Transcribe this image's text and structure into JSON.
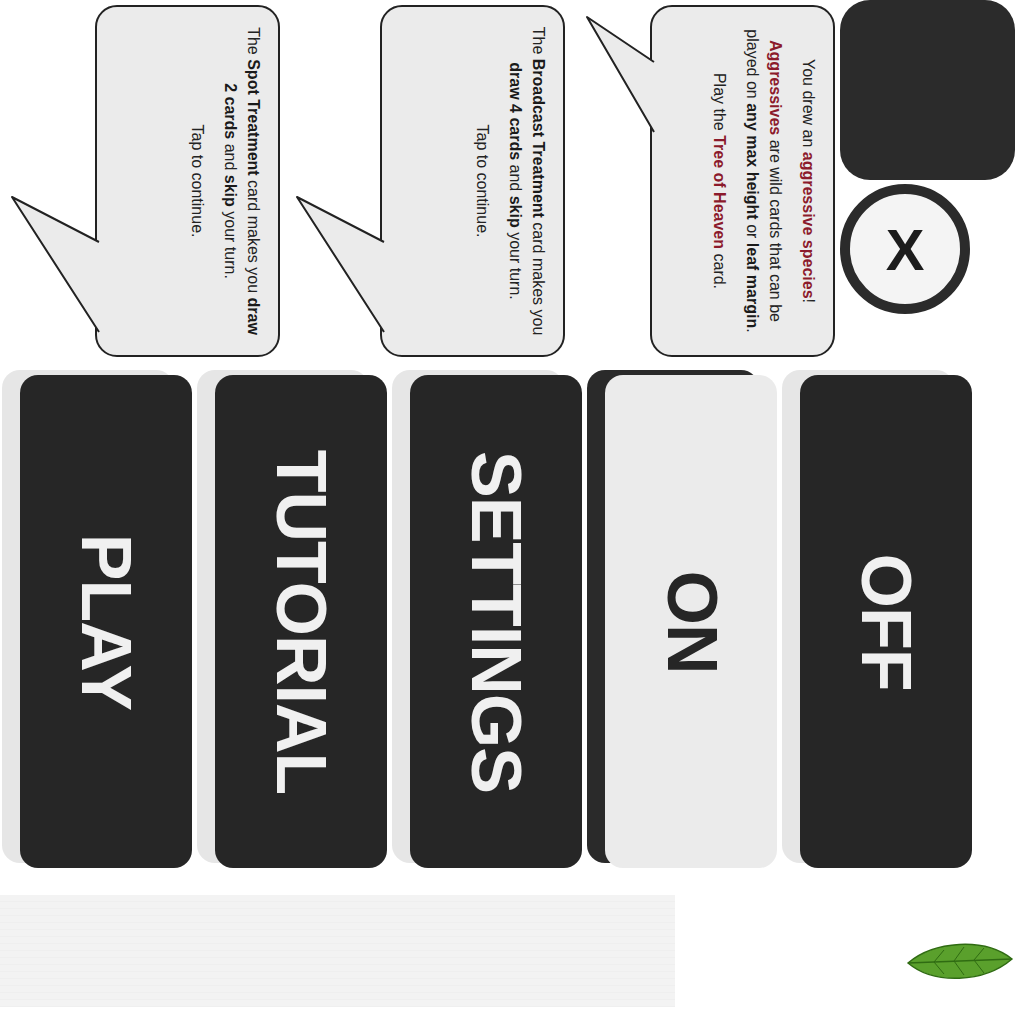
{
  "bubbles": [
    {
      "tail": "left",
      "paragraphs": [
        [
          {
            "text": "The ",
            "style": "plain"
          },
          {
            "text": "Spot Treatment",
            "style": "bold"
          },
          {
            "text": " card makes you ",
            "style": "plain"
          },
          {
            "text": "draw 2 cards",
            "style": "bold"
          },
          {
            "text": " and ",
            "style": "plain"
          },
          {
            "text": "skip",
            "style": "bold"
          },
          {
            "text": " your turn.",
            "style": "plain"
          }
        ],
        [
          {
            "text": "Tap to continue.",
            "style": "plain"
          }
        ]
      ]
    },
    {
      "tail": "left",
      "paragraphs": [
        [
          {
            "text": "The ",
            "style": "plain"
          },
          {
            "text": "Broadcast Treatment",
            "style": "bold"
          },
          {
            "text": " card makes you ",
            "style": "plain"
          },
          {
            "text": "draw 4 cards",
            "style": "bold"
          },
          {
            "text": " and ",
            "style": "plain"
          },
          {
            "text": "skip",
            "style": "bold"
          },
          {
            "text": " your turn.",
            "style": "plain"
          }
        ],
        [
          {
            "text": "Tap to continue.",
            "style": "plain"
          }
        ]
      ]
    },
    {
      "tail": "top",
      "paragraphs": [
        [
          {
            "text": "You drew an ",
            "style": "plain"
          },
          {
            "text": "aggressive species",
            "style": "red"
          },
          {
            "text": "!",
            "style": "plain"
          }
        ],
        [
          {
            "text": "Aggressives",
            "style": "red"
          },
          {
            "text": " are wild cards that can be played on ",
            "style": "plain"
          },
          {
            "text": "any max height",
            "style": "bold"
          },
          {
            "text": " or ",
            "style": "plain"
          },
          {
            "text": "leaf margin",
            "style": "bold"
          },
          {
            "text": ".",
            "style": "plain"
          }
        ],
        [
          {
            "text": "Play the ",
            "style": "plain"
          },
          {
            "text": "Tree of Heaven",
            "style": "red"
          },
          {
            "text": " card.",
            "style": "plain"
          }
        ]
      ]
    }
  ],
  "close_button": {
    "label": "X"
  },
  "buttons": [
    {
      "label": "PLAY",
      "kind": "dark"
    },
    {
      "label": "TUTORIAL",
      "kind": "dark"
    },
    {
      "label": "SETTINGS",
      "kind": "dark"
    },
    {
      "label": "ON",
      "kind": "light"
    },
    {
      "label": "OFF",
      "kind": "dark"
    }
  ]
}
